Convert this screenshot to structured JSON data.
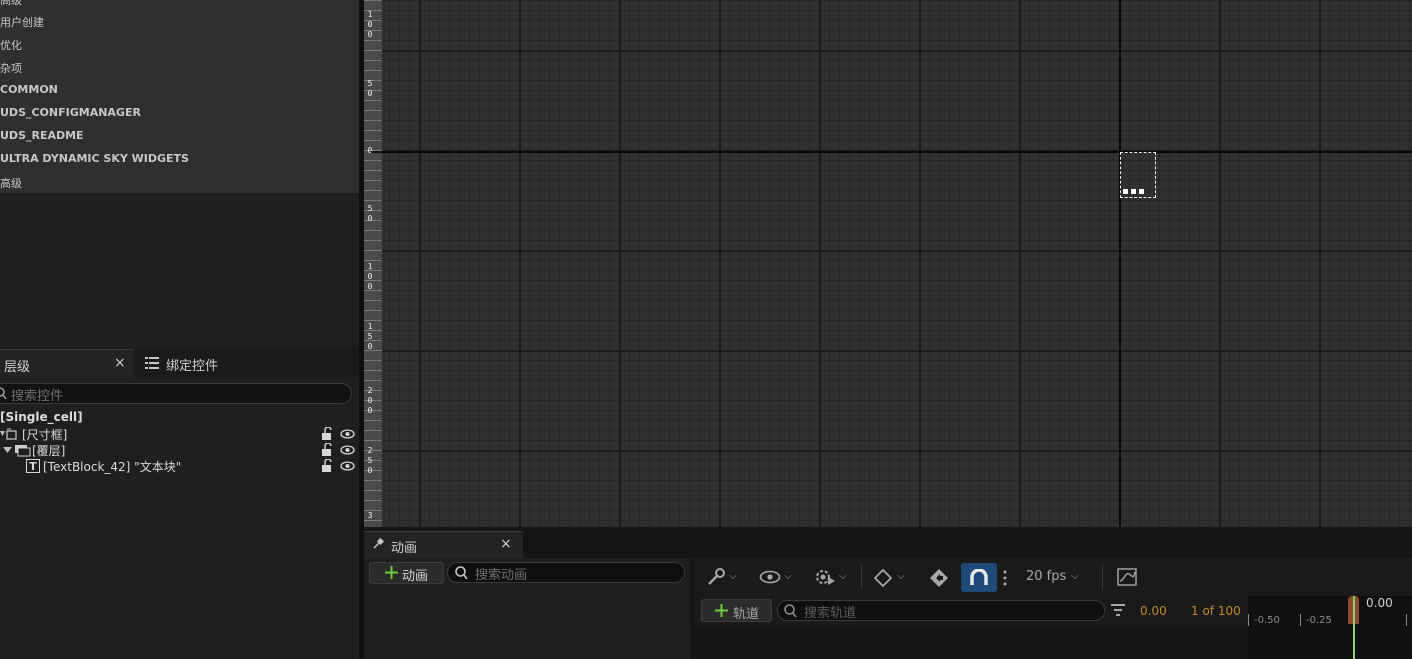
{
  "palette": {
    "categories": [
      {
        "label": "高级",
        "bold": false
      },
      {
        "label": "用户创建",
        "bold": false
      },
      {
        "label": "优化",
        "bold": false
      },
      {
        "label": "杂项",
        "bold": false
      },
      {
        "label": "COMMON",
        "bold": true
      },
      {
        "label": "UDS_CONFIGMANAGER",
        "bold": true
      },
      {
        "label": "UDS_README",
        "bold": true
      },
      {
        "label": "ULTRA DYNAMIC SKY WIDGETS",
        "bold": true
      },
      {
        "label": "高级",
        "bold": false
      }
    ]
  },
  "hierarchy": {
    "tab_label": "层级",
    "close_glyph": "×",
    "bind_tab_label": "绑定控件",
    "search_placeholder": "搜索控件",
    "root": "[Single_cell]",
    "nodes": [
      {
        "label": "[尺寸框]"
      },
      {
        "label": "[覆层]"
      },
      {
        "label": "[TextBlock_42] \"文本块\""
      }
    ]
  },
  "ruler": {
    "labels": [
      {
        "text": "1\n0\n0"
      },
      {
        "text": "5\n0"
      },
      {
        "text": "0"
      },
      {
        "text": "5\n0"
      },
      {
        "text": "1\n0\n0"
      },
      {
        "text": "1\n5\n0"
      },
      {
        "text": "2\n0\n0"
      },
      {
        "text": "2\n5\n0"
      },
      {
        "text": "3"
      }
    ]
  },
  "animation": {
    "tab_label": "动画",
    "close_glyph": "×",
    "add_button": "动画",
    "search_placeholder": "搜索动画",
    "fps_label": "20 fps",
    "add_track_button": "轨道",
    "track_search_placeholder": "搜索轨道",
    "current_time": "0.00",
    "frame_count": "1 of 100",
    "playhead_time": "0.00",
    "timeline_ticks": [
      "-0.50",
      "-0.25"
    ]
  },
  "colors": {
    "accent_orange": "#c08a2a",
    "magnet_active": "#1e4a7a",
    "add_green": "#6ecb3c",
    "playhead": "#8ad07a"
  }
}
